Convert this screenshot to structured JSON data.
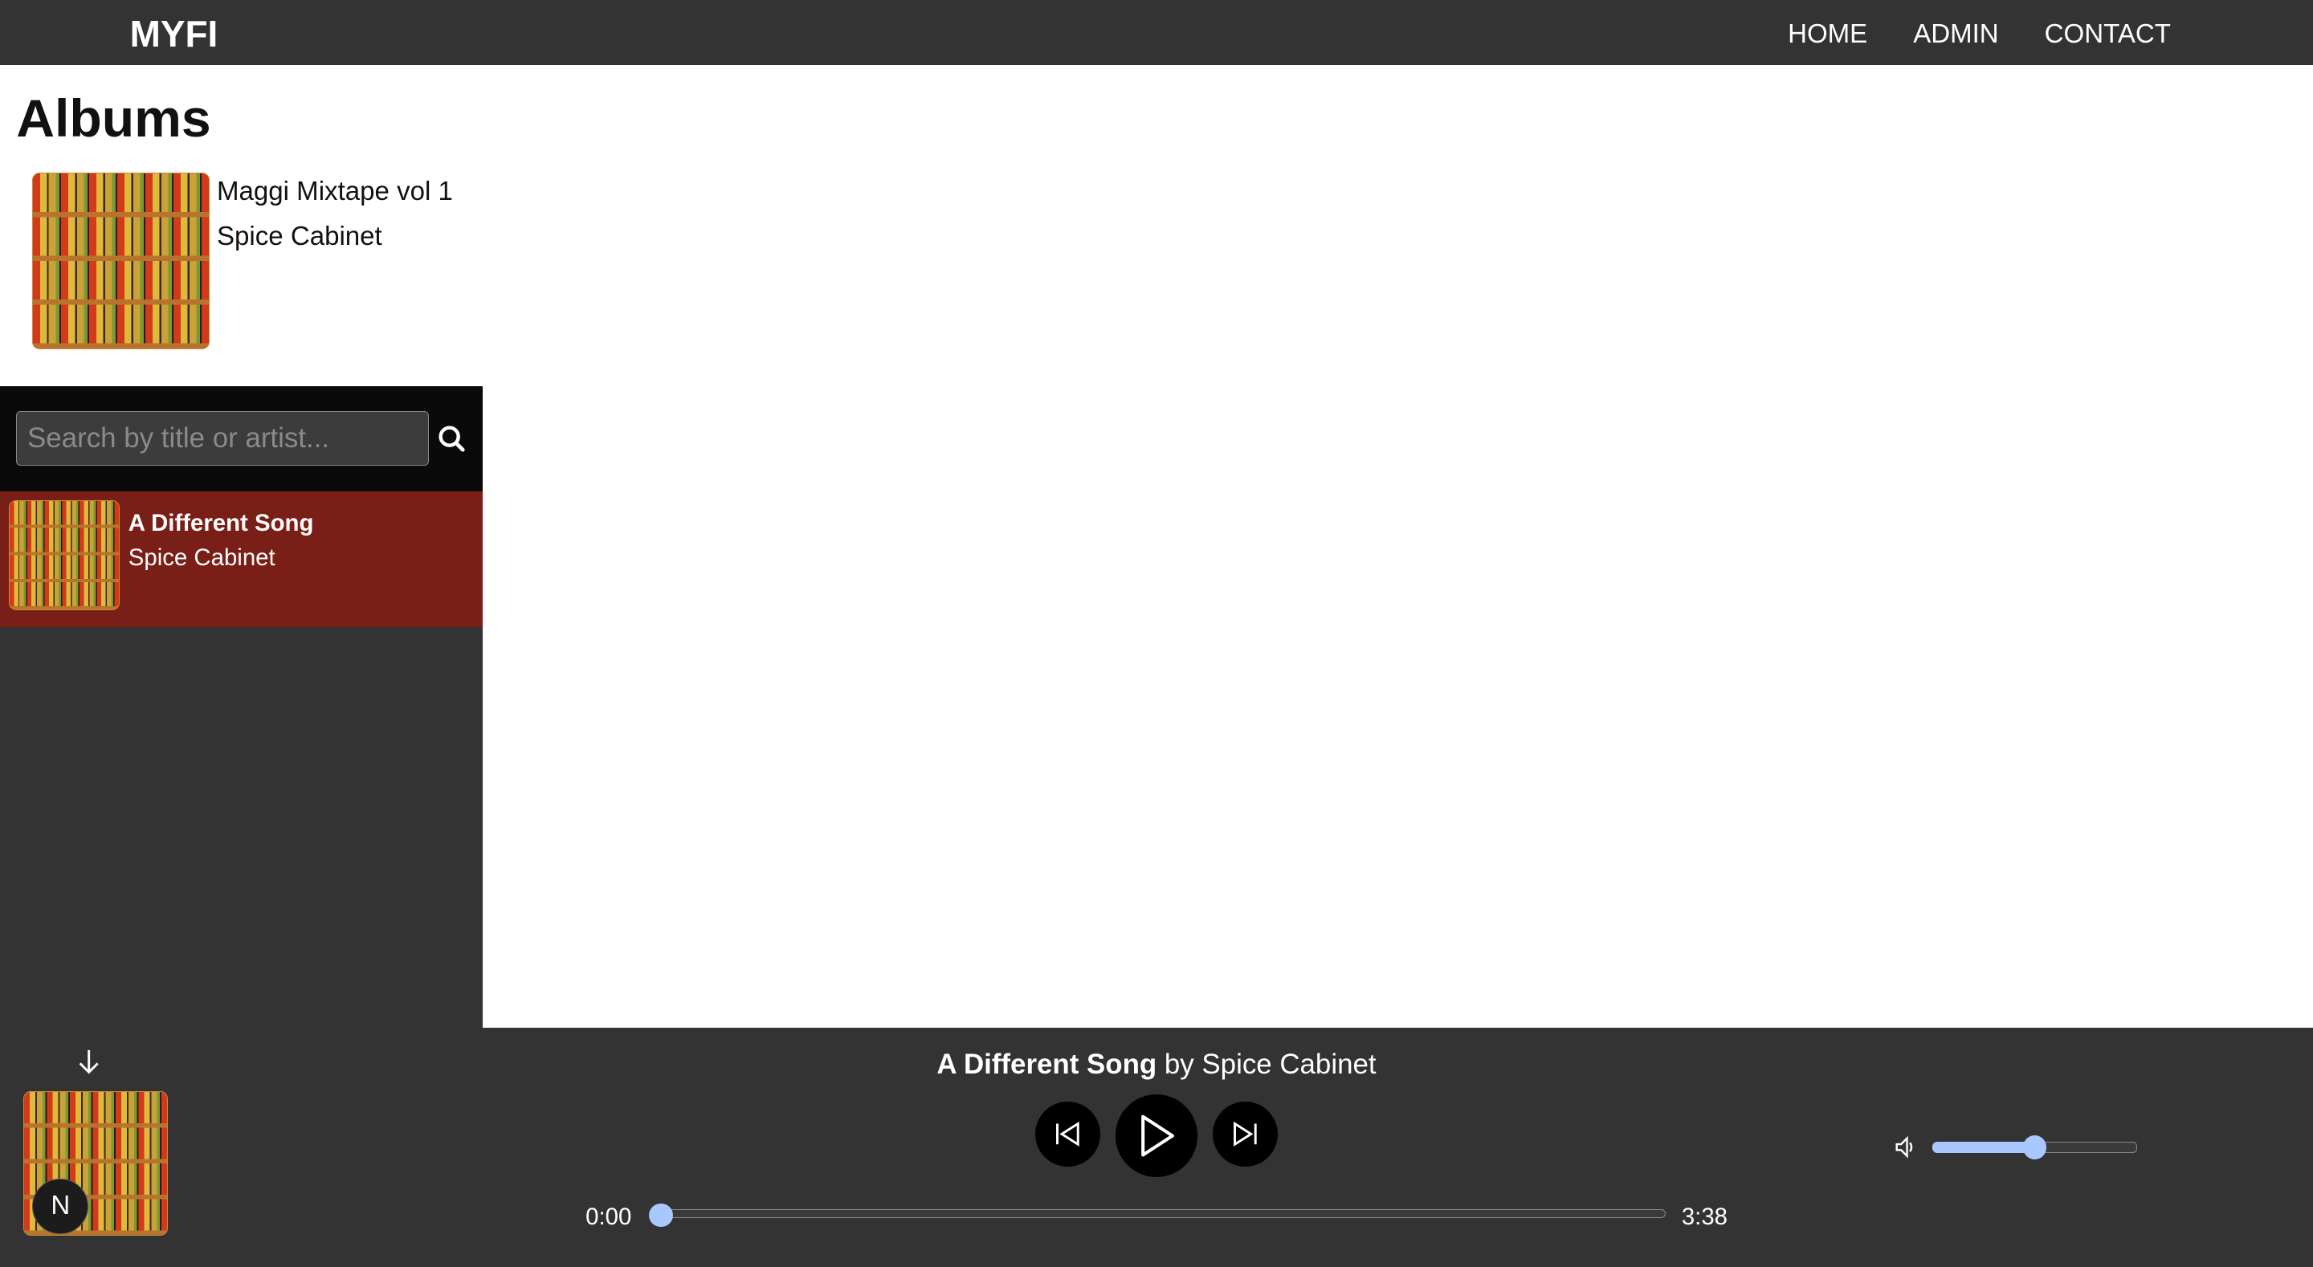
{
  "header": {
    "logo": "MYFI",
    "nav": [
      "HOME",
      "ADMIN",
      "CONTACT"
    ]
  },
  "albums": {
    "title": "Albums",
    "items": [
      {
        "name": "Maggi Mixtape vol 1",
        "artist": "Spice Cabinet"
      }
    ]
  },
  "sidebar": {
    "search_placeholder": "Search by title or artist...",
    "songs": [
      {
        "title": "A Different Song",
        "artist": "Spice Cabinet",
        "selected": true
      }
    ]
  },
  "player": {
    "song_title": "A Different Song",
    "by_artist": "by Spice Cabinet",
    "current_time": "0:00",
    "duration": "3:38",
    "progress_percent": 0,
    "volume_percent": 50,
    "badge": "N"
  },
  "colors": {
    "header": "#333333",
    "selected_row": "#7a1f17",
    "slider_accent": "#a8c8ff"
  }
}
